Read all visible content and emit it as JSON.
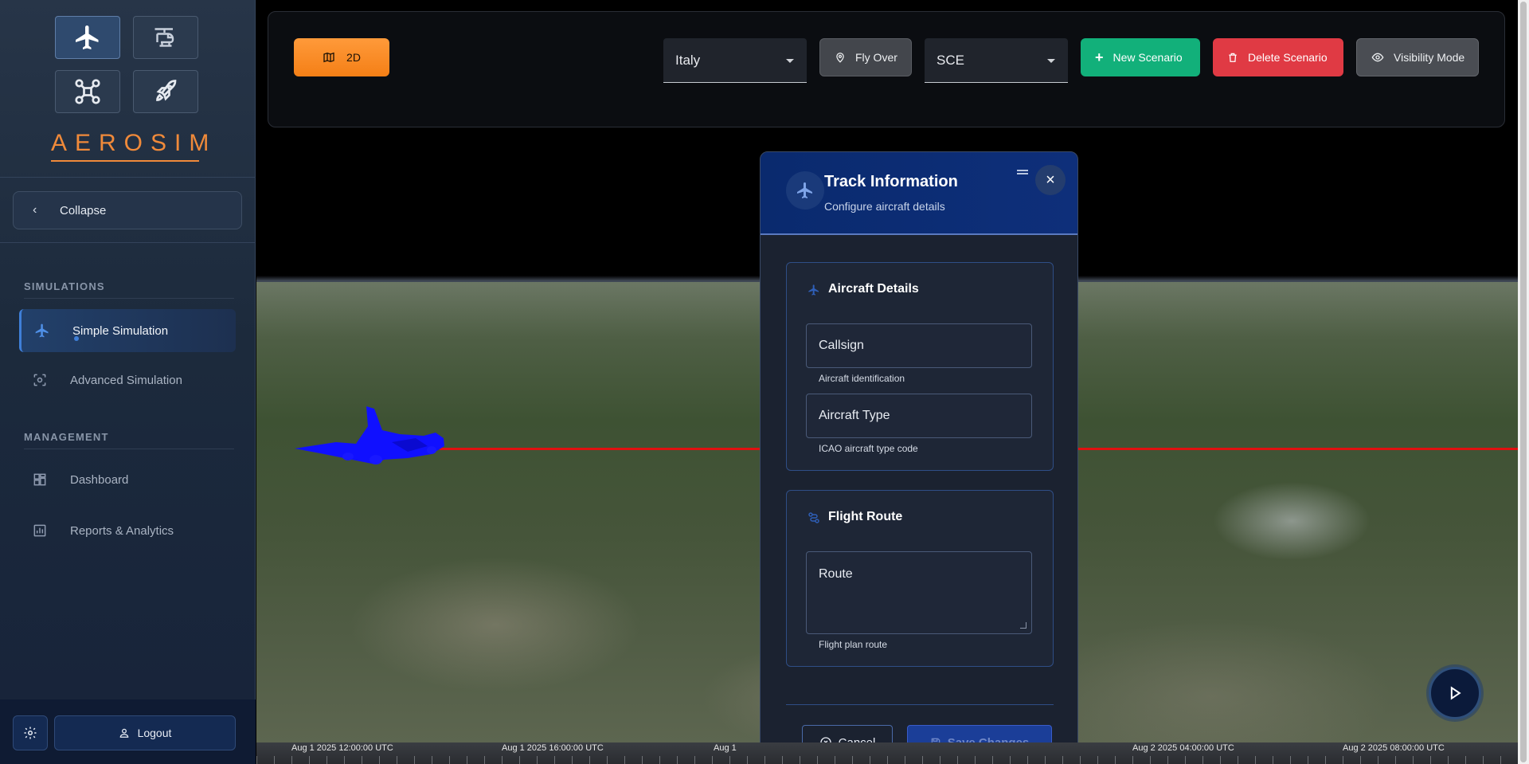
{
  "brand": {
    "name": "AEROSIM"
  },
  "sidebar": {
    "mode_icons": [
      "airplane-icon",
      "helicopter-icon",
      "drone-icon",
      "rocket-icon"
    ],
    "collapse_label": "Collapse",
    "sections": [
      {
        "title": "SIMULATIONS",
        "items": [
          {
            "label": "Simple Simulation",
            "icon": "airplane-icon",
            "active": true
          },
          {
            "label": "Advanced Simulation",
            "icon": "scan-icon",
            "active": false
          }
        ]
      },
      {
        "title": "MANAGEMENT",
        "items": [
          {
            "label": "Dashboard",
            "icon": "dashboard-icon",
            "active": false
          },
          {
            "label": "Reports & Analytics",
            "icon": "analytics-icon",
            "active": false
          }
        ]
      }
    ],
    "logout_label": "Logout"
  },
  "toolbar": {
    "view_mode_label": "2D",
    "region_select": {
      "value": "Italy"
    },
    "fly_over_label": "Fly Over",
    "scenario_select": {
      "value": "SCE"
    },
    "new_scenario_label": "New Scenario",
    "delete_scenario_label": "Delete Scenario",
    "visibility_mode_label": "Visibility Mode"
  },
  "dialog": {
    "title": "Track Information",
    "subtitle": "Configure aircraft details",
    "aircraft_details": {
      "title": "Aircraft Details",
      "callsign": {
        "label": "Callsign",
        "helper": "Aircraft identification"
      },
      "aircraft_type": {
        "label": "Aircraft Type",
        "helper": "ICAO aircraft type code"
      }
    },
    "flight_route": {
      "title": "Flight Route",
      "route": {
        "label": "Route",
        "helper": "Flight plan route"
      }
    },
    "cancel_label": "Cancel",
    "save_label": "Save Changes"
  },
  "timeline": {
    "labels": [
      "Aug 1 2025 12:00:00 UTC",
      "Aug 1 2025 16:00:00 UTC",
      "Aug 1",
      "Aug 2 2025 04:00:00 UTC",
      "Aug 2 2025 08:00:00 UTC"
    ]
  },
  "colors": {
    "accent_orange": "#f47f16",
    "new_green": "#12b07a",
    "delete_red": "#e03a44",
    "dialog_header": "#0e2f7a",
    "aircraft_blue": "#1010ff",
    "track_red": "#e01010"
  }
}
